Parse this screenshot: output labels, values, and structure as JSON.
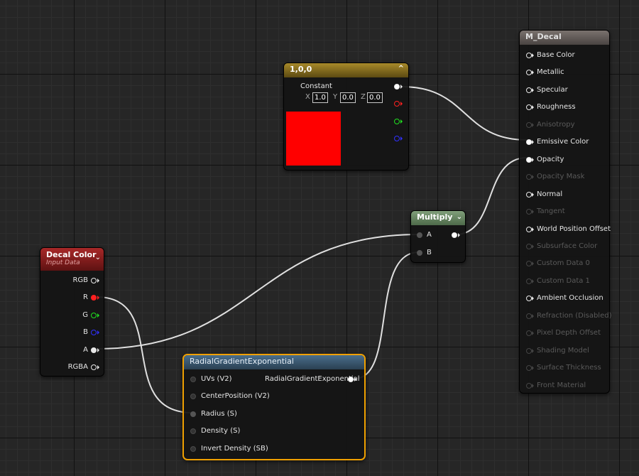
{
  "colors": {
    "material_header": "#6c6460",
    "constant_header": "#8a7320",
    "swatch": "#ff0000",
    "multiply_header": "#6f8f6a",
    "decal_header": "#8e1f1f",
    "radial_header": "#3a5a74",
    "selection": "#f0a000"
  },
  "material_node": {
    "title": "M_Decal",
    "inputs": [
      {
        "label": "Base Color",
        "enabled": true
      },
      {
        "label": "Metallic",
        "enabled": true
      },
      {
        "label": "Specular",
        "enabled": true
      },
      {
        "label": "Roughness",
        "enabled": true
      },
      {
        "label": "Anisotropy",
        "enabled": false
      },
      {
        "label": "Emissive Color",
        "enabled": true,
        "connected": true
      },
      {
        "label": "Opacity",
        "enabled": true,
        "connected": true
      },
      {
        "label": "Opacity Mask",
        "enabled": false
      },
      {
        "label": "Normal",
        "enabled": true
      },
      {
        "label": "Tangent",
        "enabled": false
      },
      {
        "label": "World Position Offset",
        "enabled": true
      },
      {
        "label": "Subsurface Color",
        "enabled": false
      },
      {
        "label": "Custom Data 0",
        "enabled": false
      },
      {
        "label": "Custom Data 1",
        "enabled": false
      },
      {
        "label": "Ambient Occlusion",
        "enabled": true
      },
      {
        "label": "Refraction (Disabled)",
        "enabled": false
      },
      {
        "label": "Pixel Depth Offset",
        "enabled": false
      },
      {
        "label": "Shading Model",
        "enabled": false
      },
      {
        "label": "Surface Thickness",
        "enabled": false
      },
      {
        "label": "Front Material",
        "enabled": false
      }
    ]
  },
  "constant_node": {
    "title": "1,0,0",
    "subtitle": "Constant",
    "x_label": "X",
    "x_value": "1.0",
    "y_label": "Y",
    "y_value": "0.0",
    "z_label": "Z",
    "z_value": "0.0",
    "collapse_glyph": "^"
  },
  "multiply_node": {
    "title": "Multiply",
    "input_a": "A",
    "input_b": "B"
  },
  "decal_node": {
    "title": "Decal Color",
    "subtitle": "Input Data",
    "outputs": [
      {
        "label": "RGB",
        "color": "#e8e8e8",
        "filled": false
      },
      {
        "label": "R",
        "color": "#ff2020",
        "filled": true
      },
      {
        "label": "G",
        "color": "#20e020",
        "filled": false
      },
      {
        "label": "B",
        "color": "#3030ff",
        "filled": false
      },
      {
        "label": "A",
        "color": "#e8e8e8",
        "filled": true
      },
      {
        "label": "RGBA",
        "color": "#e8e8e8",
        "filled": false
      }
    ]
  },
  "radial_node": {
    "title": "RadialGradientExponential",
    "output": "RadialGradientExponential",
    "inputs": [
      {
        "label": "UVs (V2)",
        "connected": false
      },
      {
        "label": "CenterPosition (V2)",
        "connected": false
      },
      {
        "label": "Radius (S)",
        "connected": true
      },
      {
        "label": "Density (S)",
        "connected": false
      },
      {
        "label": "Invert Density (SB)",
        "connected": false
      }
    ]
  }
}
